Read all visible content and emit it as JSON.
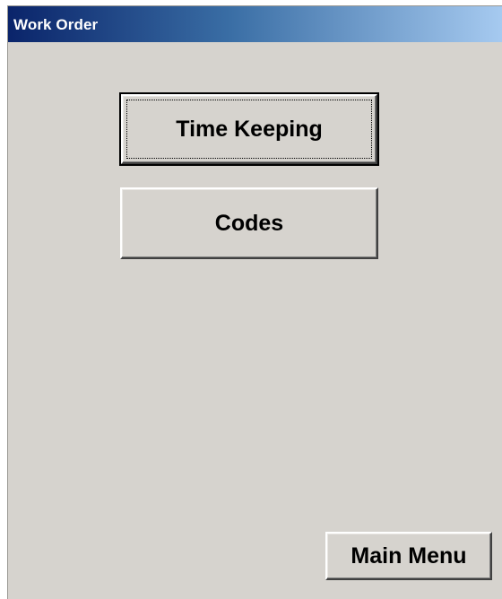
{
  "window": {
    "title": "Work Order"
  },
  "buttons": {
    "time_keeping": "Time Keeping",
    "codes": "Codes",
    "main_menu": "Main Menu"
  },
  "colors": {
    "window_background": "#d6d3ce",
    "titlebar_start": "#0a246a",
    "titlebar_end": "#a6caf0",
    "title_text": "#ffffff"
  }
}
